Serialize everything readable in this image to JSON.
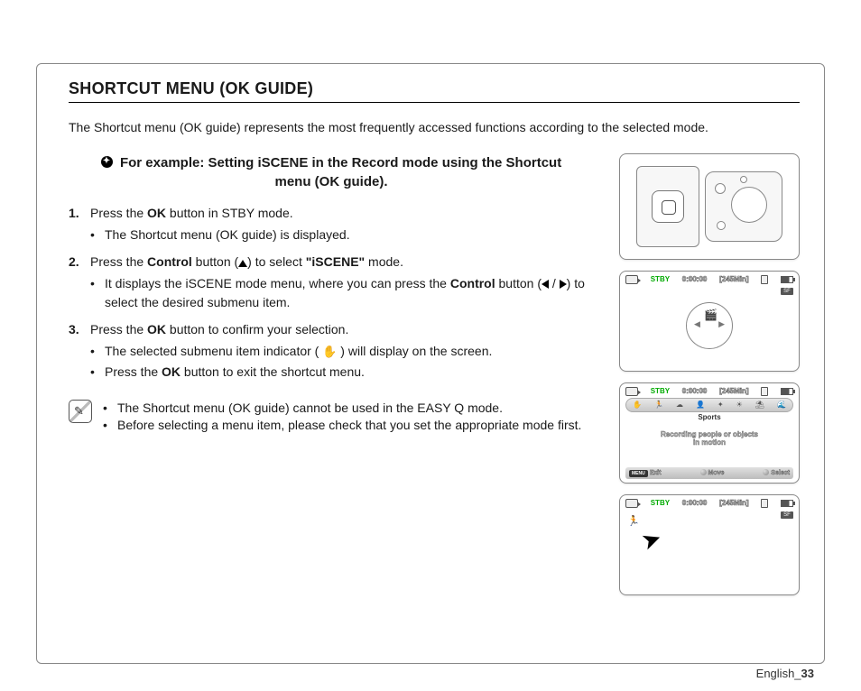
{
  "page": {
    "title": "SHORTCUT MENU (OK GUIDE)",
    "intro": "The Shortcut menu (OK guide) represents the most frequently accessed functions according to the selected mode.",
    "example_title_1": "For example: Setting iSCENE in the Record mode using the Shortcut",
    "example_title_2": "menu (OK guide).",
    "footer_lang": "English",
    "footer_page": "33"
  },
  "steps": [
    {
      "text_pre": "Press the ",
      "b1": "OK",
      "text_post": " button in STBY mode.",
      "subs": [
        {
          "text": "The Shortcut menu (OK guide) is displayed."
        }
      ]
    },
    {
      "text_pre": "Press the ",
      "b1": "Control",
      "text_mid": " button (",
      "icon": "up",
      "text_mid2": ") to select ",
      "b2": "\"iSCENE\"",
      "text_post": " mode.",
      "subs": [
        {
          "t1": "It displays the iSCENE mode menu, where you can press the ",
          "b1": "Control",
          "t2": " button (",
          "t3": " / ",
          "t4": ") to select the desired submenu item."
        }
      ]
    },
    {
      "text_pre": "Press the ",
      "b1": "OK",
      "text_post": " button to confirm your selection.",
      "subs": [
        {
          "t1": "The selected submenu item indicator ( ",
          "t2": " ) will display on the screen."
        },
        {
          "t1": "Press the ",
          "b1": "OK",
          "t2": " button to exit the shortcut menu."
        }
      ]
    }
  ],
  "notes": [
    "The Shortcut menu (OK guide) cannot be used in the EASY Q mode.",
    "Before selecting a menu item, please check that you set the appropriate mode first."
  ],
  "screens": {
    "stby": "STBY",
    "time": "0:00:00",
    "remain": "[245Min]",
    "sports": "Sports",
    "rec_line1": "Recording people or objects",
    "rec_line2": "in motion",
    "menu": "MENU",
    "exit": "Exit",
    "move": "Move",
    "select": "Select"
  }
}
